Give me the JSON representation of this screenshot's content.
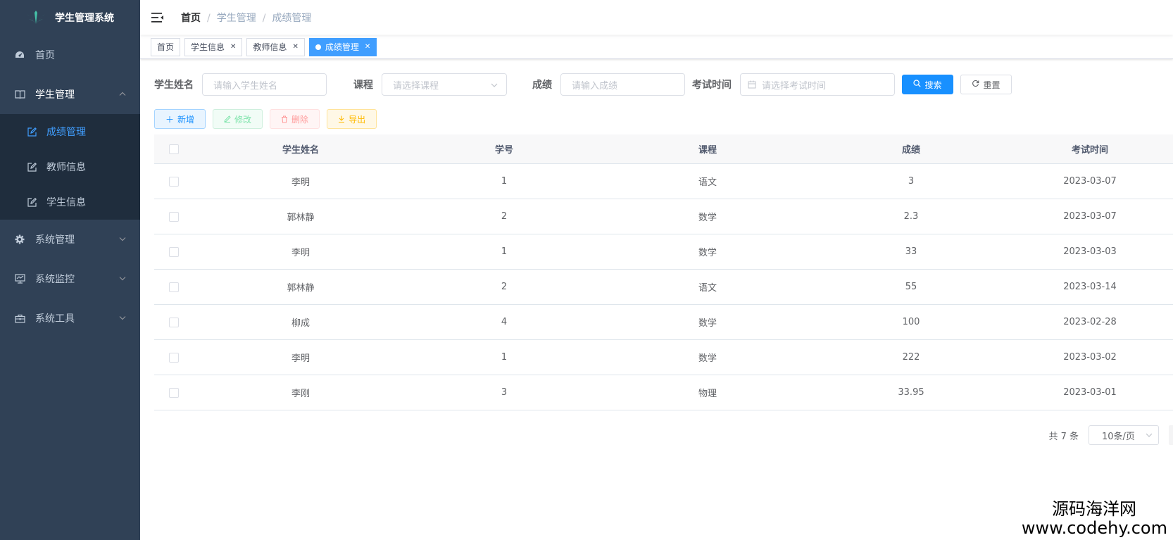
{
  "app": {
    "title": "学生管理系统"
  },
  "sidebar": {
    "home": "首页",
    "student_mgmt": "学生管理",
    "sub_items": [
      {
        "label": "成绩管理",
        "active": true
      },
      {
        "label": "教师信息",
        "active": false
      },
      {
        "label": "学生信息",
        "active": false
      }
    ],
    "system_mgmt": "系统管理",
    "system_monitor": "系统监控",
    "system_tools": "系统工具"
  },
  "breadcrumb": {
    "home": "首页",
    "mid": "学生管理",
    "current": "成绩管理",
    "sep": "/"
  },
  "tags": [
    {
      "label": "首页",
      "closable": false,
      "active": false
    },
    {
      "label": "学生信息",
      "closable": true,
      "active": false
    },
    {
      "label": "教师信息",
      "closable": true,
      "active": false
    },
    {
      "label": "成绩管理",
      "closable": true,
      "active": true
    }
  ],
  "search": {
    "name_label": "学生姓名",
    "name_placeholder": "请输入学生姓名",
    "course_label": "课程",
    "course_placeholder": "请选择课程",
    "score_label": "成绩",
    "score_placeholder": "请输入成绩",
    "time_label": "考试时间",
    "time_placeholder": "请选择考试时间",
    "search_btn": "搜索",
    "reset_btn": "重置"
  },
  "toolbar": {
    "add": "新增",
    "edit": "修改",
    "delete": "删除",
    "export": "导出"
  },
  "table": {
    "headers": [
      "学生姓名",
      "学号",
      "课程",
      "成绩",
      "考试时间"
    ],
    "rows": [
      [
        "李明",
        "1",
        "语文",
        "3",
        "2023-03-07"
      ],
      [
        "郭林静",
        "2",
        "数学",
        "2.3",
        "2023-03-07"
      ],
      [
        "李明",
        "1",
        "数学",
        "33",
        "2023-03-03"
      ],
      [
        "郭林静",
        "2",
        "语文",
        "55",
        "2023-03-14"
      ],
      [
        "柳成",
        "4",
        "数学",
        "100",
        "2023-02-28"
      ],
      [
        "李明",
        "1",
        "数学",
        "222",
        "2023-03-02"
      ],
      [
        "李刚",
        "3",
        "物理",
        "33.95",
        "2023-03-01"
      ]
    ]
  },
  "pagination": {
    "total": "共 7 条",
    "page_size": "10条/页"
  },
  "watermark": {
    "line1": "源码海洋网",
    "line2": "www.codehy.com"
  },
  "colors": {
    "sidebar_bg": "#304156",
    "submenu_bg": "#1f2d3d",
    "primary": "#1890ff"
  }
}
